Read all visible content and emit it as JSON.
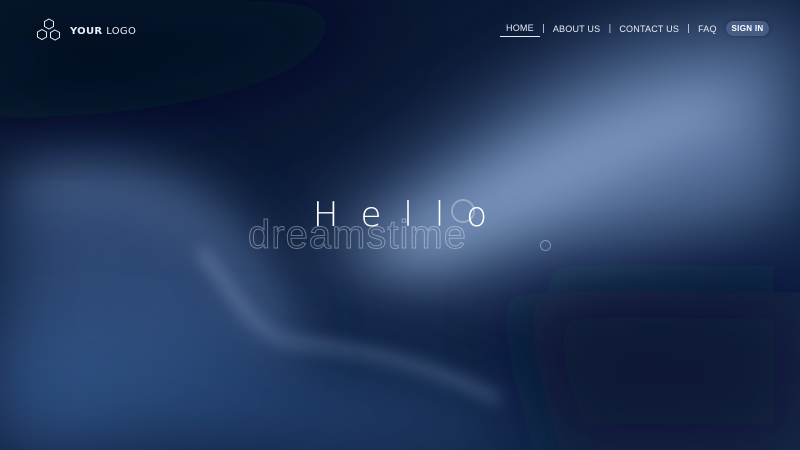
{
  "logo": {
    "text_bold": "YOUR",
    "text_light": "LOGO"
  },
  "nav": {
    "items": [
      {
        "label": "HOME"
      },
      {
        "label": "ABOUT US"
      },
      {
        "label": "CONTACT US"
      },
      {
        "label": "FAQ"
      }
    ],
    "separator": "|",
    "signin_label": "SIGN IN"
  },
  "hero": {
    "title": "Hello"
  },
  "watermark": {
    "text": "dreamstime"
  },
  "colors": {
    "background": "#0b1833",
    "glow": "#8aa8d2",
    "button": "#475d86"
  }
}
